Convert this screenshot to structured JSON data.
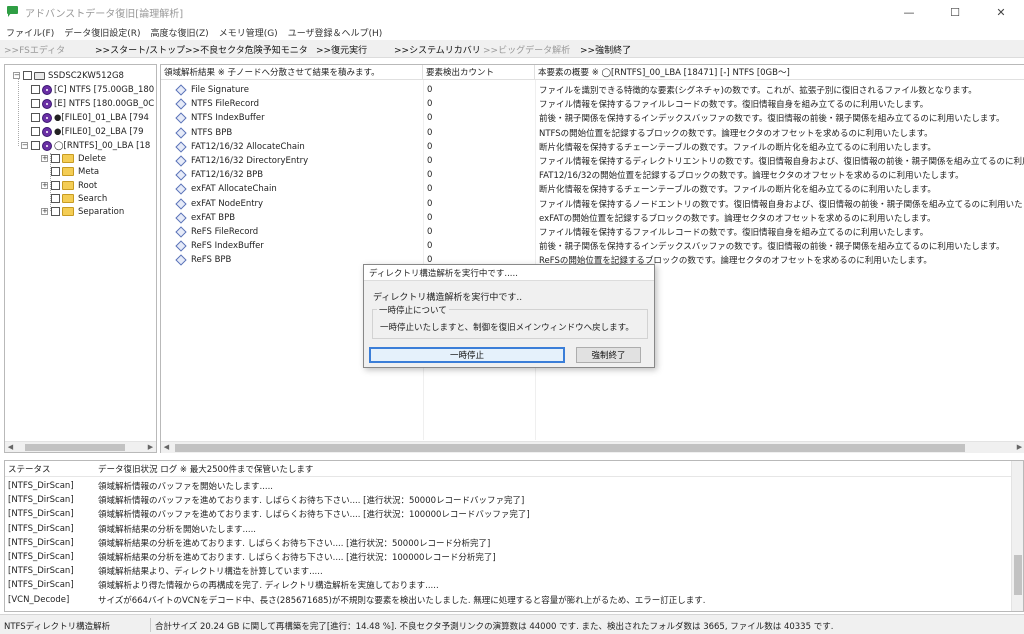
{
  "window": {
    "title": "アドバンストデータ復旧[論理解析]",
    "controls": {
      "minimize": "—",
      "maximize": "☐",
      "close": "✕"
    }
  },
  "menu": [
    "ファイル(F)",
    "データ復旧設定(R)",
    "高度な復旧(Z)",
    "メモリ管理(G)",
    "ユーザ登録＆ヘルプ(H)"
  ],
  "toolbar": [
    {
      "label": ">>FSエディタ",
      "enabled": false
    },
    {
      "label": ">>スタート/ストップ",
      "enabled": true
    },
    {
      "label": ">>不良セクタ危険予知モニタ",
      "enabled": true
    },
    {
      "label": ">>復元実行",
      "enabled": true
    },
    {
      "label": ">>システムリカバリ",
      "enabled": true
    },
    {
      "label": ">>ビッグデータ解析",
      "enabled": false
    },
    {
      "label": ">>強制終了",
      "enabled": true
    }
  ],
  "tree": {
    "root": "SSDSC2KW512G8",
    "volumes": [
      "[C] NTFS [75.00GB_180",
      "[E] NTFS [180.00GB_0C",
      "●[FILE0]_01_LBA [794",
      "●[FILE0]_02_LBA [79",
      "◯[RNTFS]_00_LBA [18"
    ],
    "folders": [
      "Delete",
      "Meta",
      "Root",
      "Search",
      "Separation"
    ]
  },
  "results": {
    "headers": {
      "name": "領域解析結果 ※ 子ノードへ分散させて結果を積みます。",
      "count": "要素検出カウント",
      "desc": "本要素の概要 ※ ◯[RNTFS]_00_LBA [18471] [-] NTFS [0GB～]"
    },
    "rows": [
      {
        "name": "File Signature",
        "count": "0",
        "desc": "ファイルを識別できる特徴的な要素(シグネチャ)の数です。これが、拡張子別に復旧されるファイル数となります。"
      },
      {
        "name": "NTFS FileRecord",
        "count": "0",
        "desc": "ファイル情報を保持するファイルレコードの数です。復旧情報自身を組み立てるのに利用いたします。"
      },
      {
        "name": "NTFS IndexBuffer",
        "count": "0",
        "desc": "前後・親子関係を保持するインデックスバッファの数です。復旧情報の前後・親子関係を組み立てるのに利用いたします。"
      },
      {
        "name": "NTFS BPB",
        "count": "0",
        "desc": "NTFSの開始位置を記録するブロックの数です。論理セクタのオフセットを求めるのに利用いたします。"
      },
      {
        "name": "FAT12/16/32 AllocateChain",
        "count": "0",
        "desc": "断片化情報を保持するチェーンテーブルの数です。ファイルの断片化を組み立てるのに利用いたします。"
      },
      {
        "name": "FAT12/16/32 DirectoryEntry",
        "count": "0",
        "desc": "ファイル情報を保持するディレクトリエントリの数です。復旧情報自身および、復旧情報の前後・親子関係を組み立てるのに利用いたします。"
      },
      {
        "name": "FAT12/16/32 BPB",
        "count": "0",
        "desc": "FAT12/16/32の開始位置を記録するブロックの数です。論理セクタのオフセットを求めるのに利用いたします。"
      },
      {
        "name": "exFAT AllocateChain",
        "count": "0",
        "desc": "断片化情報を保持するチェーンテーブルの数です。ファイルの断片化を組み立てるのに利用いたします。"
      },
      {
        "name": "exFAT NodeEntry",
        "count": "0",
        "desc": "ファイル情報を保持するノードエントリの数です。復旧情報自身および、復旧情報の前後・親子関係を組み立てるのに利用いたします。"
      },
      {
        "name": "exFAT BPB",
        "count": "0",
        "desc": "exFATの開始位置を記録するブロックの数です。論理セクタのオフセットを求めるのに利用いたします。"
      },
      {
        "name": "ReFS FileRecord",
        "count": "0",
        "desc": "ファイル情報を保持するファイルレコードの数です。復旧情報自身を組み立てるのに利用いたします。"
      },
      {
        "name": "ReFS IndexBuffer",
        "count": "0",
        "desc": "前後・親子関係を保持するインデックスバッファの数です。復旧情報の前後・親子関係を組み立てるのに利用いたします。"
      },
      {
        "name": "ReFS BPB",
        "count": "0",
        "desc": "ReFSの開始位置を記録するブロックの数です。論理セクタのオフセットを求めるのに利用いたします。"
      }
    ]
  },
  "dialog": {
    "title": "ディレクトリ構造解析を実行中です.....",
    "message": "ディレクトリ構造解析を実行中です..",
    "group_label": "一時停止について",
    "group_text": "一時停止いたしますと、制御を復旧メインウィンドウへ戻します。",
    "pause_button": "一時停止",
    "force_button": "強制終了"
  },
  "log": {
    "header_status": "ステータス",
    "header_message": "データ復旧状況 ログ ※ 最大2500件まで保管いたします",
    "rows": [
      {
        "status": "[NTFS_DirScan]",
        "message": "領域解析情報のバッファを開始いたします....."
      },
      {
        "status": "[NTFS_DirScan]",
        "message": "領域解析情報のバッファを進めております. しばらくお待ち下さい.... [進行状況：50000レコードバッファ完了]"
      },
      {
        "status": "[NTFS_DirScan]",
        "message": "領域解析情報のバッファを進めております. しばらくお待ち下さい.... [進行状況：100000レコードバッファ完了]"
      },
      {
        "status": "[NTFS_DirScan]",
        "message": "領域解析結果の分析を開始いたします....."
      },
      {
        "status": "[NTFS_DirScan]",
        "message": "領域解析結果の分析を進めております. しばらくお待ち下さい.... [進行状況：50000レコード分析完了]"
      },
      {
        "status": "[NTFS_DirScan]",
        "message": "領域解析結果の分析を進めております. しばらくお待ち下さい.... [進行状況：100000レコード分析完了]"
      },
      {
        "status": "[NTFS_DirScan]",
        "message": "領域解析結果より、ディレクトリ構造を計算しています....."
      },
      {
        "status": "[NTFS_DirScan]",
        "message": "領域解析より得た情報からの再構成を完了. ディレクトリ構造解析を実施しております....."
      },
      {
        "status": "[VCN_Decode]",
        "message": "サイズが664バイトのVCNをデコード中、長さ(285671685)が不規則な要素を検出いたしました. 無理に処理すると容量が膨れ上がるため、エラー訂正します."
      }
    ]
  },
  "statusbar": {
    "left": "NTFSディレクトリ構造解析",
    "right": "合計サイズ 20.24 GB に関して再構築を完了[進行：14.48 %]. 不良セクタ予測リンクの演算数は 44000 です. また、検出されたフォルダ数は 3665, ファイル数は 40335 です."
  }
}
